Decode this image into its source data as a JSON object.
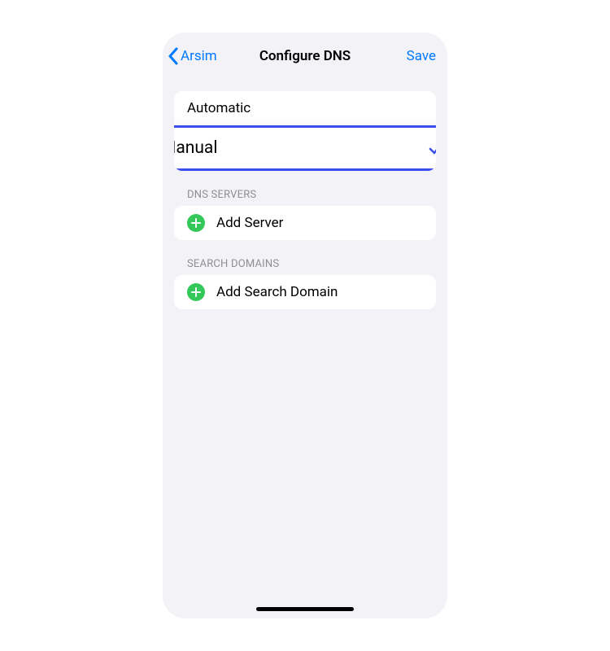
{
  "header": {
    "back_label": "Arsim",
    "title": "Configure DNS",
    "save_label": "Save"
  },
  "dns_mode": {
    "automatic_label": "Automatic",
    "manual_label": "Manual"
  },
  "sections": {
    "dns_servers": {
      "header": "DNS SERVERS",
      "add_label": "Add Server"
    },
    "search_domains": {
      "header": "SEARCH DOMAINS",
      "add_label": "Add Search Domain"
    }
  }
}
